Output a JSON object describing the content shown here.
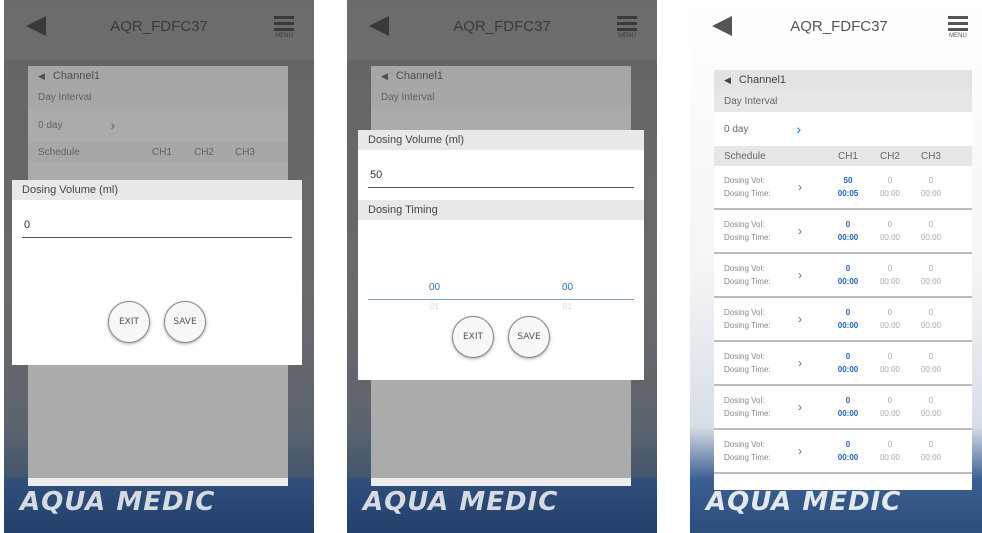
{
  "common": {
    "app_title": "AQR_FDFC37",
    "menu_label": "MENU",
    "channel_label": "Channel1",
    "day_interval_label": "Day Interval",
    "day_value": "0 day",
    "schedule_header": {
      "label": "Schedule",
      "ch1": "CH1",
      "ch2": "CH2",
      "ch3": "CH3"
    },
    "dosing_vol_label": "Dosing Vol:",
    "dosing_time_label": "Dosing Time:",
    "exit_label": "EXIT",
    "save_label": "SAVE",
    "logo_text": "AQUA MEDIC"
  },
  "screen1": {
    "dialog_title": "Dosing Volume (ml)",
    "input_value": "0"
  },
  "screen2": {
    "dialog_title": "Dosing Volume (ml)",
    "input_value": "50",
    "timing_title": "Dosing Timing",
    "hour_value": "00",
    "minute_value": "00",
    "hour_next": "01",
    "minute_next": "01"
  },
  "screen3": {
    "rows": [
      {
        "ch1_vol": "50",
        "ch1_time": "00:05",
        "ch2_vol": "0",
        "ch2_time": "00:00",
        "ch3_vol": "0",
        "ch3_time": "00:00"
      },
      {
        "ch1_vol": "0",
        "ch1_time": "00:00",
        "ch2_vol": "0",
        "ch2_time": "00:00",
        "ch3_vol": "0",
        "ch3_time": "00:00"
      },
      {
        "ch1_vol": "0",
        "ch1_time": "00:00",
        "ch2_vol": "0",
        "ch2_time": "00:00",
        "ch3_vol": "0",
        "ch3_time": "00:00"
      },
      {
        "ch1_vol": "0",
        "ch1_time": "00:00",
        "ch2_vol": "0",
        "ch2_time": "00:00",
        "ch3_vol": "0",
        "ch3_time": "00:00"
      },
      {
        "ch1_vol": "0",
        "ch1_time": "00:00",
        "ch2_vol": "0",
        "ch2_time": "00:00",
        "ch3_vol": "0",
        "ch3_time": "00:00"
      },
      {
        "ch1_vol": "0",
        "ch1_time": "00:00",
        "ch2_vol": "0",
        "ch2_time": "00:00",
        "ch3_vol": "0",
        "ch3_time": "00:00"
      },
      {
        "ch1_vol": "0",
        "ch1_time": "00:00",
        "ch2_vol": "0",
        "ch2_time": "00:00",
        "ch3_vol": "0",
        "ch3_time": "00:00"
      }
    ]
  }
}
